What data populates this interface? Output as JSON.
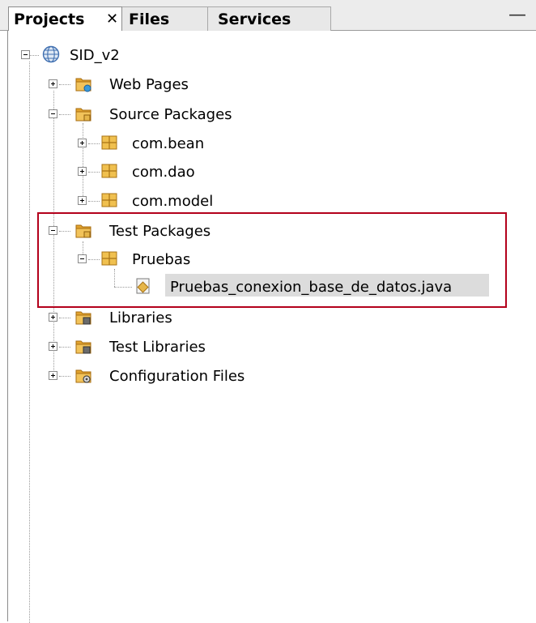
{
  "tabs": {
    "projects": "Projects",
    "files": "Files",
    "services": "Services",
    "close_glyph": "✕",
    "minimize_glyph": "—"
  },
  "tree": {
    "project": "SID_v2",
    "web_pages": "Web Pages",
    "source_packages": "Source Packages",
    "pkg_bean": "com.bean",
    "pkg_dao": "com.dao",
    "pkg_model": "com.model",
    "test_packages": "Test Packages",
    "pkg_pruebas": "Pruebas",
    "java_file": "Pruebas_conexion_base_de_datos.java",
    "libraries": "Libraries",
    "test_libraries": "Test Libraries",
    "configuration_files": "Configuration Files"
  },
  "colors": {
    "highlight_border": "#b3001b",
    "selection_bg": "#dcdcdc",
    "folder": "#e2a32e",
    "package": "#e6b64a"
  },
  "icons": {
    "project": "globe-icon",
    "folder": "folder-icon",
    "package": "package-icon",
    "java_file": "java-file-icon"
  }
}
